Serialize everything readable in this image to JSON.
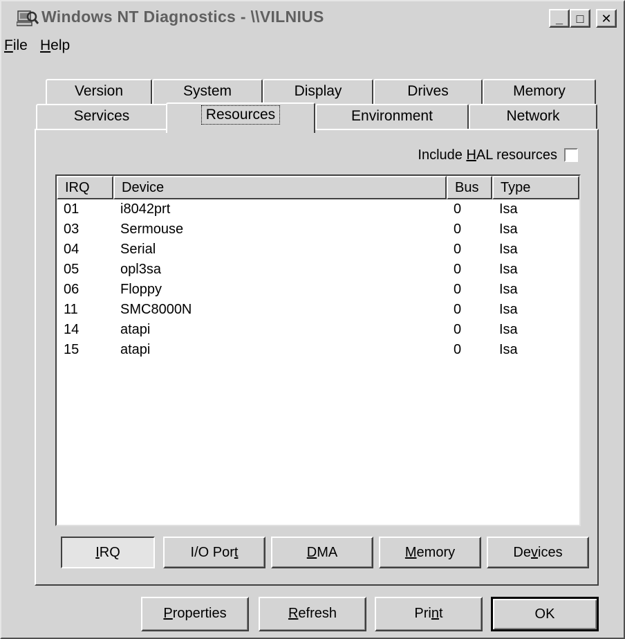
{
  "window": {
    "title": "Windows NT Diagnostics - \\\\VILNIUS",
    "icon": "computer-magnifier-icon",
    "controls": {
      "minimize": "_",
      "maximize": "□",
      "close": "✕"
    }
  },
  "menu": {
    "file": {
      "accel": "F",
      "rest": "ile"
    },
    "help": {
      "accel": "H",
      "rest": "elp"
    }
  },
  "tabs": {
    "row1": [
      "Version",
      "System",
      "Display",
      "Drives",
      "Memory"
    ],
    "row2": [
      "Services",
      "Resources",
      "Environment",
      "Network"
    ],
    "active": "Resources"
  },
  "resources": {
    "hal": {
      "pre": "Include ",
      "accel": "H",
      "post": "AL resources",
      "checked": false
    },
    "columns": {
      "irq": "IRQ",
      "device": "Device",
      "bus": "Bus",
      "type": "Type"
    },
    "rows": [
      {
        "irq": "01",
        "device": "i8042prt",
        "bus": "0",
        "type": "Isa"
      },
      {
        "irq": "03",
        "device": "Sermouse",
        "bus": "0",
        "type": "Isa"
      },
      {
        "irq": "04",
        "device": "Serial",
        "bus": "0",
        "type": "Isa"
      },
      {
        "irq": "05",
        "device": "opl3sa",
        "bus": "0",
        "type": "Isa"
      },
      {
        "irq": "06",
        "device": "Floppy",
        "bus": "0",
        "type": "Isa"
      },
      {
        "irq": "11",
        "device": "SMC8000N",
        "bus": "0",
        "type": "Isa"
      },
      {
        "irq": "14",
        "device": "atapi",
        "bus": "0",
        "type": "Isa"
      },
      {
        "irq": "15",
        "device": "atapi",
        "bus": "0",
        "type": "Isa"
      }
    ],
    "view_buttons": {
      "irq": {
        "pre": "",
        "accel": "I",
        "post": "RQ"
      },
      "io": {
        "pre": "I/O Por",
        "accel": "t",
        "post": ""
      },
      "dma": {
        "pre": "",
        "accel": "D",
        "post": "MA"
      },
      "memory": {
        "pre": "",
        "accel": "M",
        "post": "emory"
      },
      "devices": {
        "pre": "De",
        "accel": "v",
        "post": "ices"
      },
      "selected": "IRQ"
    }
  },
  "buttons": {
    "properties": {
      "pre": "",
      "accel": "P",
      "post": "roperties"
    },
    "refresh": {
      "pre": "",
      "accel": "R",
      "post": "efresh"
    },
    "print": {
      "pre": "Pri",
      "accel": "n",
      "post": "t"
    },
    "ok": "OK"
  },
  "colors": {
    "face": "#d4d4d4",
    "highlight": "#ffffff",
    "shadow": "#808080",
    "dark_shadow": "#404040",
    "title_text": "#606060"
  }
}
